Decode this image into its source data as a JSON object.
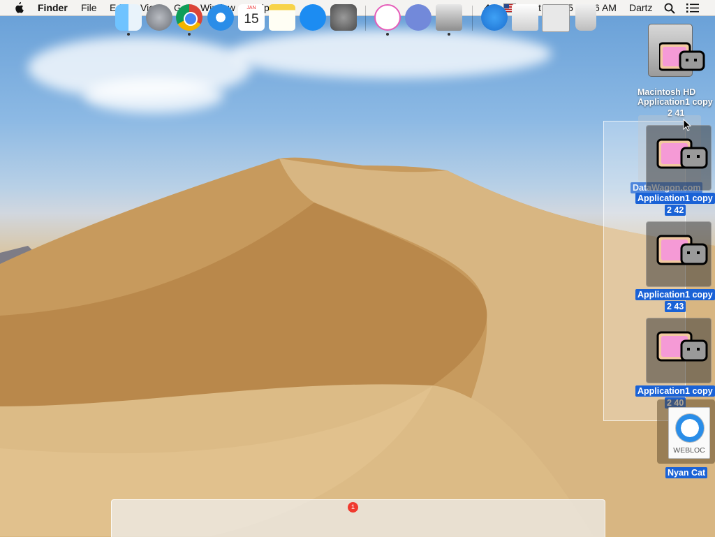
{
  "menubar": {
    "app_name": "Finder",
    "menus": [
      "File",
      "Edit",
      "View",
      "Go",
      "Window",
      "Help"
    ],
    "datetime": "Sat Jan 15  11:26 AM",
    "user": "Dartz"
  },
  "desktop": {
    "icons": [
      {
        "label": "Macintosh HD",
        "icon": "hard-drive-icon"
      },
      {
        "label": "Application1 copy",
        "sub": "2 41",
        "icon": "nyan-cat-app-icon",
        "dragging": true
      },
      {
        "label": "DataWagon.com",
        "icon": "webloc-file-icon"
      },
      {
        "label": "Application1 copy",
        "sub": "2 42",
        "icon": "nyan-cat-app-icon",
        "selected": true
      },
      {
        "label": "Application1 copy",
        "sub": "2 43",
        "icon": "nyan-cat-app-icon",
        "selected": true
      },
      {
        "label": "Application1 copy",
        "sub": "2 40",
        "icon": "nyan-cat-app-icon",
        "selected": true
      },
      {
        "label": "Nyan Cat",
        "icon": "safari-webloc-icon",
        "file_ext": "WEBLOC",
        "selected": true
      }
    ]
  },
  "dock": {
    "apps": [
      {
        "name": "Finder",
        "icon": "finder-icon",
        "running": true
      },
      {
        "name": "Launchpad",
        "icon": "launchpad-icon",
        "running": false
      },
      {
        "name": "Google Chrome",
        "icon": "chrome-icon",
        "running": true
      },
      {
        "name": "Safari",
        "icon": "safari-icon",
        "running": false
      },
      {
        "name": "Calendar",
        "icon": "calendar-icon",
        "running": false,
        "month": "JAN",
        "day": "15"
      },
      {
        "name": "Notes",
        "icon": "notes-icon",
        "running": false
      },
      {
        "name": "App Store",
        "icon": "app-store-icon",
        "running": false
      },
      {
        "name": "System Preferences",
        "icon": "system-preferences-icon",
        "running": false,
        "badge": "1"
      },
      {
        "name": "iTunes",
        "icon": "itunes-icon",
        "running": true
      },
      {
        "name": "Discord",
        "icon": "discord-icon",
        "running": false
      },
      {
        "name": "Installer",
        "icon": "installer-icon",
        "running": true
      },
      {
        "name": "Applications",
        "icon": "applications-folder-icon",
        "running": false
      },
      {
        "name": "Disk Image",
        "icon": "disk-image-icon",
        "running": false
      },
      {
        "name": "Script",
        "icon": "script-file-icon",
        "running": false
      },
      {
        "name": "Trash",
        "icon": "trash-icon",
        "running": false
      }
    ]
  },
  "colors": {
    "selection_blue": "#1a62d6",
    "badge_red": "#f03a2e"
  }
}
